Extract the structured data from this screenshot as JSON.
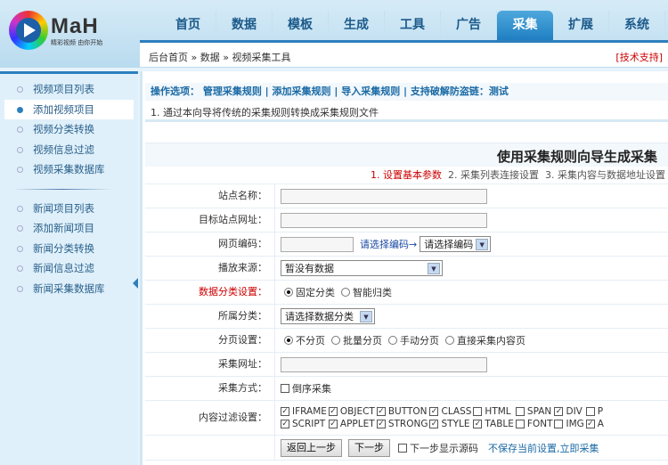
{
  "header": {
    "brand": "MaH",
    "slogan": "精彩视频 由你开始",
    "nav": [
      "首页",
      "数据",
      "模板",
      "生成",
      "工具",
      "广告",
      "采集",
      "扩展",
      "系统"
    ],
    "active_nav": 6,
    "breadcrumb": "后台首页 » 数据 » 视频采集工具",
    "support": "[技术支持]"
  },
  "sidebar": {
    "video": [
      "视频项目列表",
      "添加视频项目",
      "视频分类转换",
      "视频信息过滤",
      "视频采集数据库"
    ],
    "news": [
      "新闻项目列表",
      "添加新闻项目",
      "新闻分类转换",
      "新闻信息过滤",
      "新闻采集数据库"
    ],
    "active": "添加视频项目"
  },
  "ops": {
    "label": "操作选项：",
    "links": [
      "管理采集规则",
      "添加采集规则",
      "导入采集规则",
      "支持破解防盗链：测试"
    ]
  },
  "note": "1. 通过本向导将传统的采集规则转换成采集规则文件",
  "title": "使用采集规则向导生成采集",
  "steps": {
    "s1": "1. 设置基本参数",
    "s2": "2. 采集列表连接设置",
    "s3": "3. 采集内容与数据地址设置"
  },
  "form": {
    "site_name": {
      "label": "站点名称：",
      "value": ""
    },
    "site_url": {
      "label": "目标站点网址：",
      "value": ""
    },
    "encoding": {
      "label": "网页编码：",
      "value": "",
      "hint": "请选择编码→",
      "select": "请选择编码"
    },
    "source": {
      "label": "播放来源：",
      "select": "暂没有数据"
    },
    "category_mode": {
      "label": "数据分类设置：",
      "options": [
        "固定分类",
        "智能归类"
      ],
      "selected": 0
    },
    "category": {
      "label": "所属分类：",
      "select": "请选择数据分类"
    },
    "paging": {
      "label": "分页设置：",
      "options": [
        "不分页",
        "批量分页",
        "手动分页",
        "直接采集内容页"
      ],
      "selected": 0
    },
    "collect_url": {
      "label": "采集网址：",
      "value": ""
    },
    "method": {
      "label": "采集方式：",
      "option": "倒序采集",
      "checked": false
    },
    "filter": {
      "label": "内容过滤设置：",
      "items": [
        {
          "name": "IFRAME",
          "checked": true
        },
        {
          "name": "OBJECT",
          "checked": true
        },
        {
          "name": "BUTTON",
          "checked": true
        },
        {
          "name": "CLASS",
          "checked": true
        },
        {
          "name": "HTML",
          "checked": false
        },
        {
          "name": "SPAN",
          "checked": false
        },
        {
          "name": "DIV",
          "checked": true
        },
        {
          "name": "P",
          "checked": false
        },
        {
          "name": "SCRIPT",
          "checked": true
        },
        {
          "name": "APPLET",
          "checked": true
        },
        {
          "name": "STRONG",
          "checked": true
        },
        {
          "name": "STYLE",
          "checked": true
        },
        {
          "name": "TABLE",
          "checked": true
        },
        {
          "name": "FONT",
          "checked": false
        },
        {
          "name": "IMG",
          "checked": false
        },
        {
          "name": "A",
          "checked": true
        }
      ]
    },
    "actions": {
      "back": "返回上一步",
      "next": "下一步",
      "show_source": "下一步显示源码",
      "collect_now": "不保存当前设置,立即采集"
    }
  }
}
